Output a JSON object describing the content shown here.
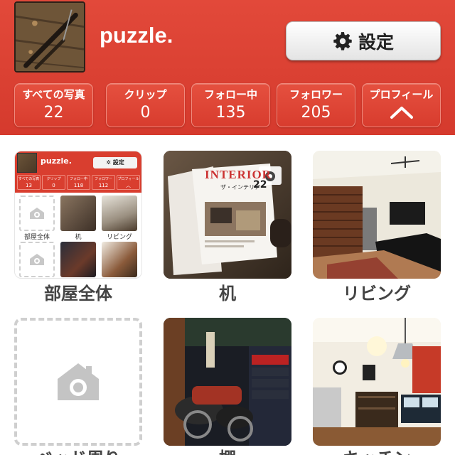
{
  "profile": {
    "username": "puzzle.",
    "settings_label": "設定"
  },
  "stats": [
    {
      "label": "すべての写真",
      "value": "22"
    },
    {
      "label": "クリップ",
      "value": "0"
    },
    {
      "label": "フォロー中",
      "value": "135"
    },
    {
      "label": "フォロワー",
      "value": "205"
    },
    {
      "label": "プロフィール",
      "value": ""
    }
  ],
  "albums": [
    {
      "label": "部屋全体"
    },
    {
      "label": "机"
    },
    {
      "label": "リビング"
    },
    {
      "label": "ベッド周り"
    },
    {
      "label": "棚"
    },
    {
      "label": "キッチン"
    }
  ],
  "magazine": {
    "title": "INTERIOR",
    "subtitle": "ザ・インテリア",
    "number": "22"
  },
  "mini": {
    "username": "puzzle.",
    "settings_label": "設定",
    "stats": [
      {
        "label": "すべての写真",
        "value": "13"
      },
      {
        "label": "クリップ",
        "value": "0"
      },
      {
        "label": "フォロー中",
        "value": "118"
      },
      {
        "label": "フォロワー",
        "value": "112"
      },
      {
        "label": "プロフィール",
        "value": ""
      }
    ],
    "labels": [
      "部屋全体",
      "机",
      "リビング"
    ]
  },
  "colors": {
    "brand": "#d93e2f",
    "placeholder_border": "#cfcfcf"
  },
  "icons": [
    "gear-icon",
    "chevron-up-icon",
    "camera-house-icon"
  ]
}
